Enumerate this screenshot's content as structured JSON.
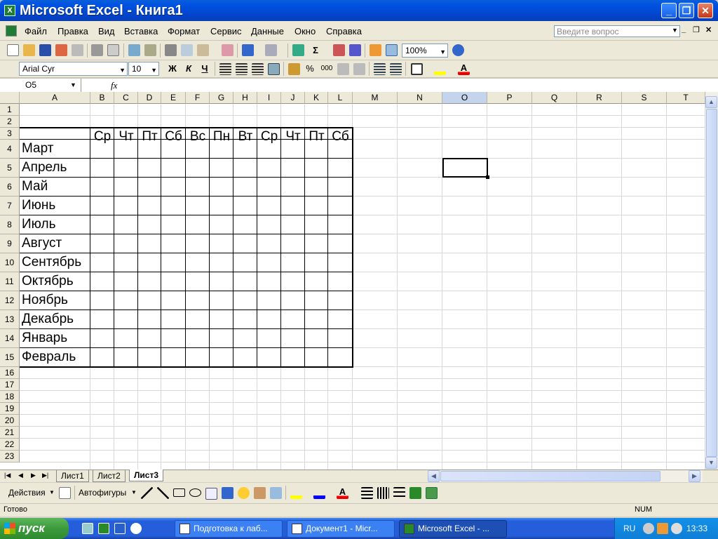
{
  "window": {
    "title": "Microsoft Excel - Книга1",
    "minimize": "_",
    "restore": "❐",
    "close": "✕"
  },
  "menu": {
    "items": [
      "Файл",
      "Правка",
      "Вид",
      "Вставка",
      "Формат",
      "Сервис",
      "Данные",
      "Окно",
      "Справка"
    ],
    "help_placeholder": "Введите вопрос"
  },
  "toolbar": {
    "zoom": "100%",
    "font": "Arial Cyr",
    "size": "10",
    "bold": "Ж",
    "italic": "К",
    "underline": "Ч",
    "percent": "%",
    "thousands": "000",
    "sigma": "Σ"
  },
  "formula_bar": {
    "name_box": "O5",
    "fx": "fx",
    "value": ""
  },
  "columns": [
    "A",
    "B",
    "C",
    "D",
    "E",
    "F",
    "G",
    "H",
    "I",
    "J",
    "K",
    "L",
    "M",
    "N",
    "O",
    "P",
    "Q",
    "R",
    "S",
    "T"
  ],
  "rows": [
    "1",
    "2",
    "3",
    "4",
    "5",
    "6",
    "7",
    "8",
    "9",
    "10",
    "11",
    "12",
    "13",
    "14",
    "15",
    "16",
    "17",
    "18",
    "19",
    "20",
    "21",
    "22",
    "23"
  ],
  "cells": {
    "day_headers": [
      "Ср",
      "Чт",
      "Пт",
      "Сб",
      "Вс",
      "Пн",
      "Вт",
      "Ср",
      "Чт",
      "Пт",
      "Сб"
    ],
    "months": [
      "Март",
      "Апрель",
      "Май",
      "Июнь",
      "Июль",
      "Август",
      "Сентябрь",
      "Октябрь",
      "Ноябрь",
      "Декабрь",
      "Январь",
      "Февраль"
    ]
  },
  "sheets": [
    "Лист1",
    "Лист2",
    "Лист3"
  ],
  "active_sheet": "Лист3",
  "drawing": {
    "actions": "Действия",
    "autoshapes": "Автофигуры"
  },
  "status": {
    "ready": "Готово",
    "num": "NUM"
  },
  "taskbar": {
    "start": "пуск",
    "tasks": [
      "Подготовка к лаб...",
      "Документ1 - Micr...",
      "Microsoft Excel - ..."
    ],
    "lang": "RU",
    "clock": "13:33"
  },
  "colors": {
    "titlebar": "#0054e3",
    "taskbar": "#245edb",
    "start": "#3c9a3c",
    "selected_col": "#c4d4ec"
  }
}
